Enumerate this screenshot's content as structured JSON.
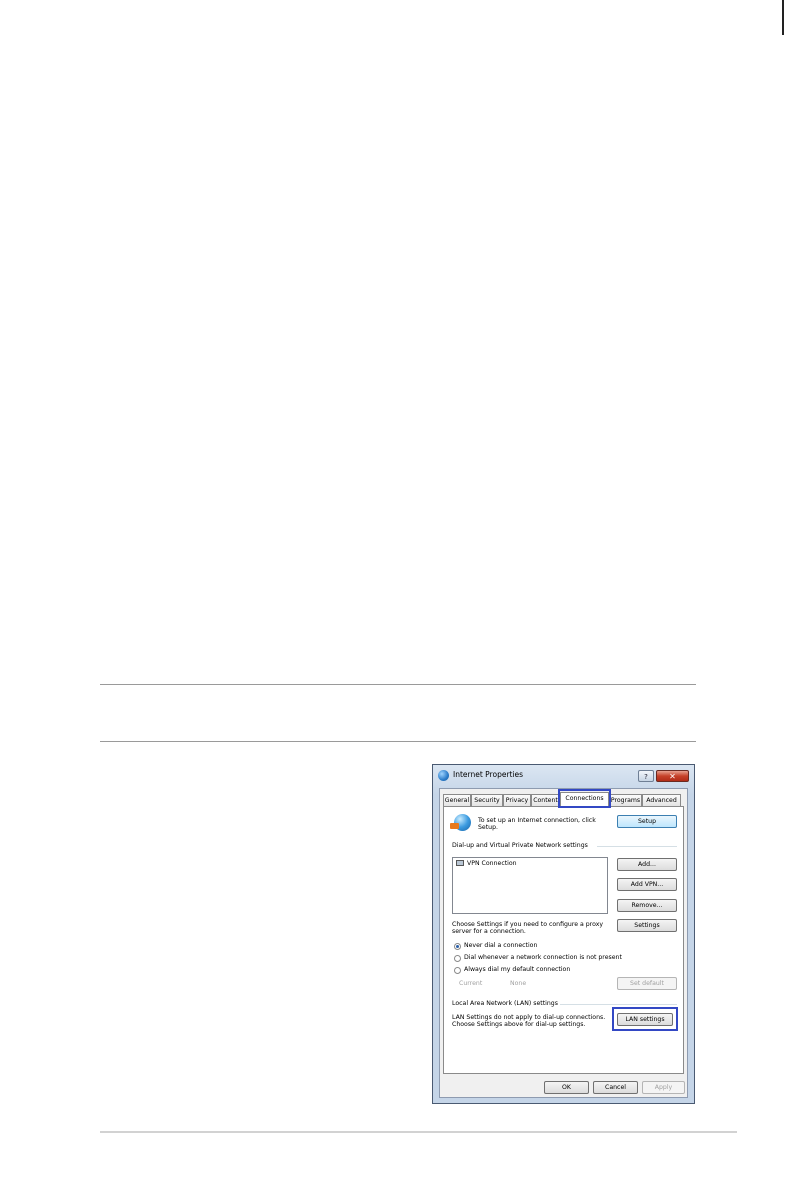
{
  "dialog": {
    "title": "Internet Properties",
    "help_label": "?",
    "close_label": "✕",
    "tabs": [
      "General",
      "Security",
      "Privacy",
      "Content",
      "Connections",
      "Programs",
      "Advanced"
    ],
    "active_tab": "Connections",
    "setup_text_line1": "To set up an Internet connection, click",
    "setup_text_line2": "Setup.",
    "setup_button": "Setup",
    "dialup_heading": "Dial-up and Virtual Private Network settings",
    "vpn_items": [
      "VPN Connection"
    ],
    "add_button": "Add...",
    "add_vpn_button": "Add VPN...",
    "remove_button": "Remove...",
    "proxy_text_line1": "Choose Settings if you need to configure a proxy",
    "proxy_text_line2": "server for a connection.",
    "settings_button": "Settings",
    "radio_options": [
      "Never dial a connection",
      "Dial whenever a network connection is not present",
      "Always dial my default connection"
    ],
    "radio_selected": 0,
    "current_label": "Current",
    "current_value": "None",
    "set_default_button": "Set default",
    "lan_heading": "Local Area Network (LAN) settings",
    "lan_text_line1": "LAN Settings do not apply to dial-up connections.",
    "lan_text_line2": "Choose Settings above for dial-up settings.",
    "lan_button": "LAN settings",
    "ok_button": "OK",
    "cancel_button": "Cancel",
    "apply_button": "Apply"
  },
  "colors": {
    "highlight": "#3348c4",
    "title_bar": "#c5d5e8",
    "close_button": "#c6412a"
  }
}
